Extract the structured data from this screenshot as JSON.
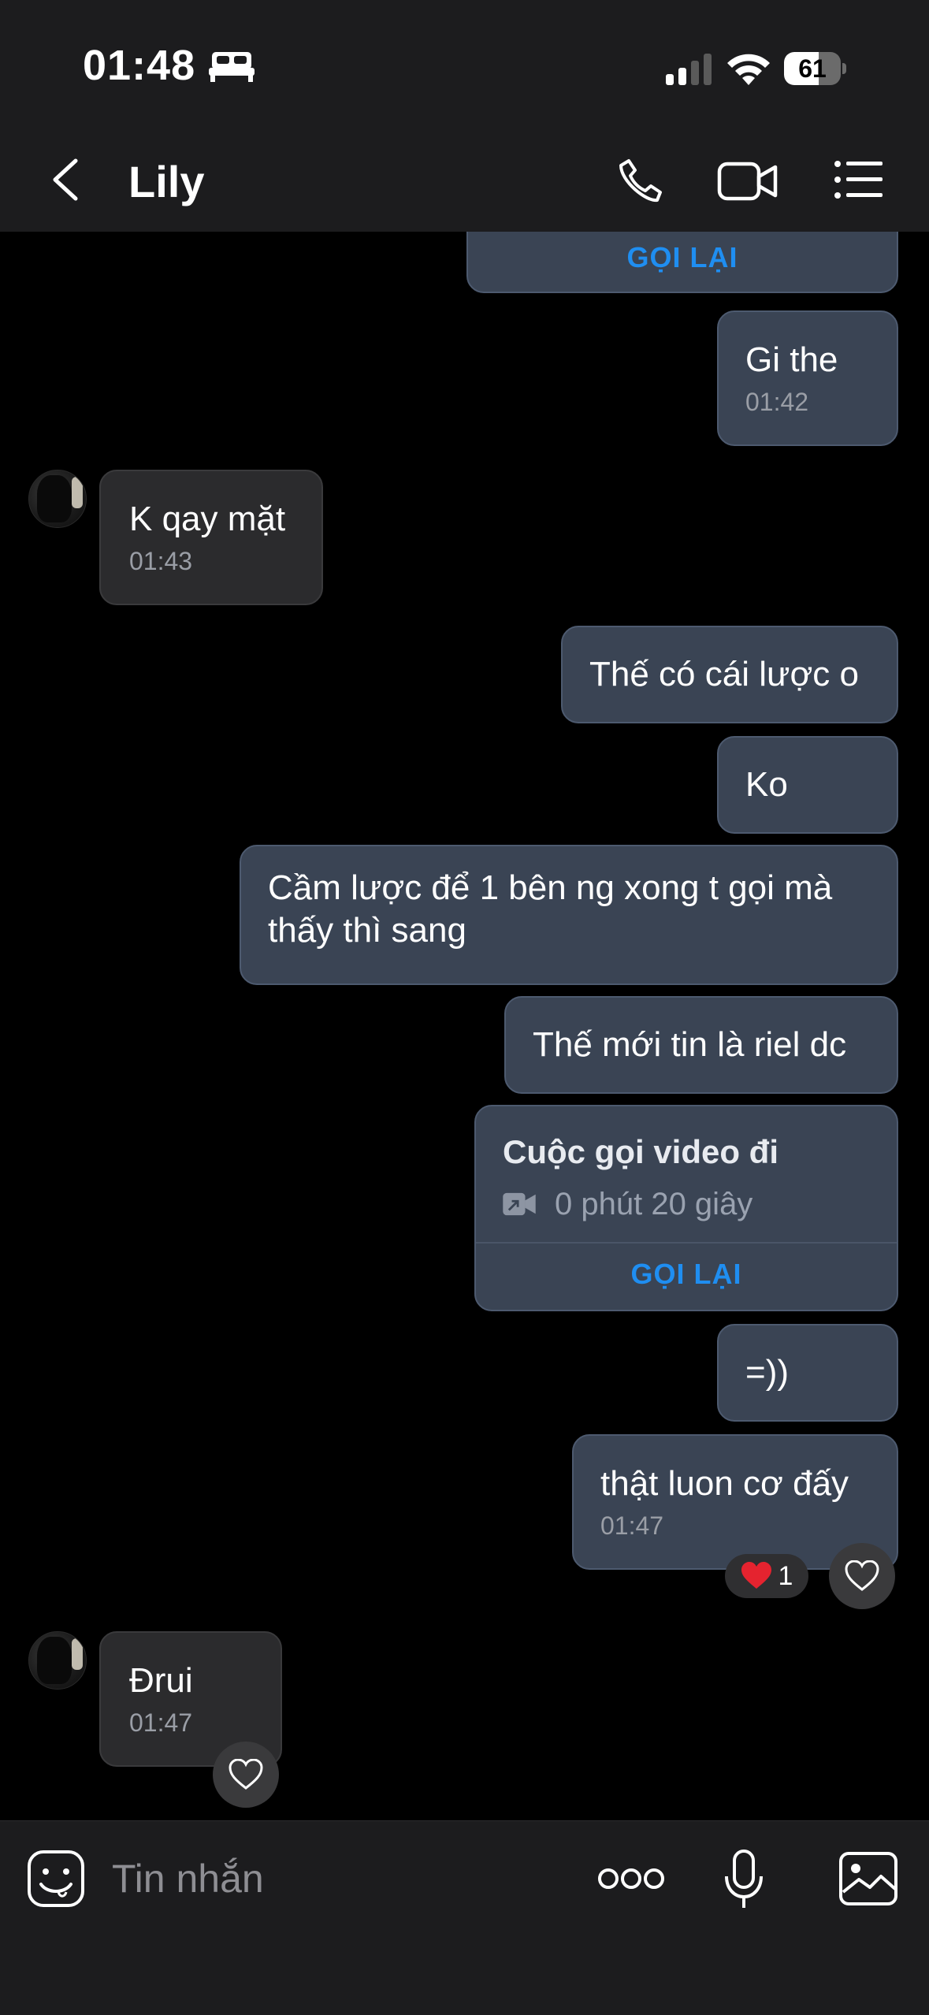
{
  "status_bar": {
    "time": "01:48",
    "battery": "61",
    "battery_level": 0.61
  },
  "header": {
    "title": "Lily"
  },
  "messages": {
    "m0": {
      "callback": "GỌI LẠI"
    },
    "m1": {
      "text": "Gi the",
      "time": "01:42"
    },
    "m2": {
      "text": "K qay mặt",
      "time": "01:43"
    },
    "m3": {
      "text": "Thế có cái lược o"
    },
    "m4": {
      "text": "Ko"
    },
    "m5": {
      "text": "Cầm lược để 1 bên ng xong t gọi mà thấy thì sang"
    },
    "m6": {
      "text": "Thế mới tin là riel dc"
    },
    "m7": {
      "title": "Cuộc gọi video đi",
      "duration": "0 phút 20 giây",
      "callback": "GỌI LẠI"
    },
    "m8": {
      "text": "=))"
    },
    "m9": {
      "text": "thật luon cơ đấy",
      "time": "01:47",
      "reaction_count": "1"
    },
    "m10": {
      "text": "Đrui",
      "time": "01:47"
    }
  },
  "input": {
    "placeholder": "Tin nhắn"
  },
  "colors": {
    "outgoing_bubble": "#3a4454",
    "incoming_bubble": "#2b2b2d",
    "accent": "#1f8ef1",
    "heart": "#e5232f"
  }
}
